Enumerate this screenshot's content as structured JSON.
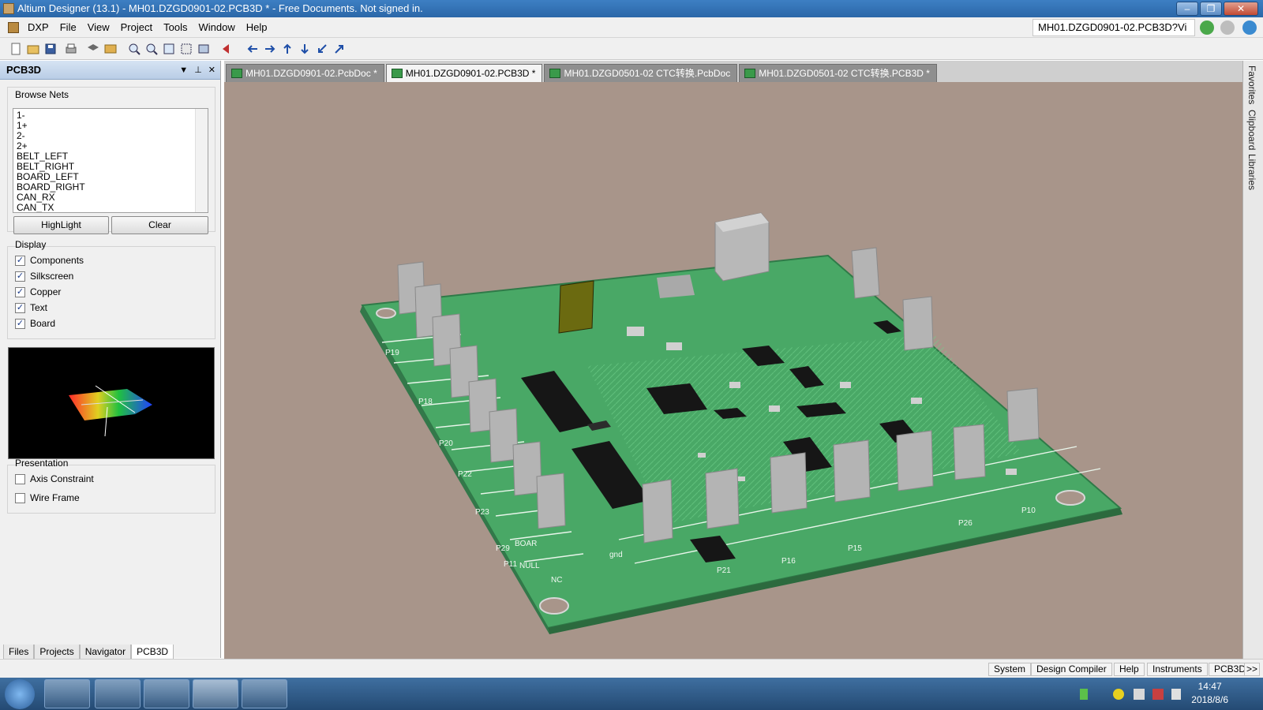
{
  "window": {
    "title": "Altium Designer (13.1) - MH01.DZGD0901-02.PCB3D * - Free Documents. Not signed in.",
    "controls": [
      "–",
      "❐",
      "✕"
    ]
  },
  "menu": {
    "dxp": "DXP",
    "items": [
      "File",
      "View",
      "Project",
      "Tools",
      "Window",
      "Help"
    ],
    "path": "MH01.DZGD0901-02.PCB3D?Vi"
  },
  "panel": {
    "title": "PCB3D",
    "header_buttons": [
      "▼",
      "⊥",
      "✕"
    ],
    "browse_nets": {
      "label": "Browse Nets",
      "nets": [
        "1-",
        "1+",
        "2-",
        "2+",
        "BELT_LEFT",
        "BELT_RIGHT",
        "BOARD_LEFT",
        "BOARD_RIGHT",
        "CAN_RX",
        "CAN_TX"
      ],
      "highlight_label": "HighLight",
      "clear_label": "Clear"
    },
    "display": {
      "label": "Display",
      "options": [
        {
          "label": "Components",
          "checked": true
        },
        {
          "label": "Silkscreen",
          "checked": true
        },
        {
          "label": "Copper",
          "checked": true
        },
        {
          "label": "Text",
          "checked": true
        },
        {
          "label": "Board",
          "checked": true
        }
      ]
    },
    "presentation": {
      "label": "Presentation",
      "options": [
        {
          "label": "Axis Constraint",
          "checked": false
        },
        {
          "label": "Wire Frame",
          "checked": false
        }
      ]
    },
    "bottom_tabs": [
      "Files",
      "Projects",
      "Navigator",
      "PCB3D"
    ],
    "active_bottom_tab": "PCB3D"
  },
  "document_tabs": [
    {
      "label": "MH01.DZGD0901-02.PcbDoc *",
      "active": false
    },
    {
      "label": "MH01.DZGD0901-02.PCB3D *",
      "active": true
    },
    {
      "label": "MH01.DZGD0501-02 CTC转换.PcbDoc",
      "active": false
    },
    {
      "label": "MH01.DZGD0501-02 CTC转换.PCB3D *",
      "active": false
    }
  ],
  "right_dock": [
    "Favorites",
    "Clipboard",
    "Libraries"
  ],
  "status_bar": {
    "buttons": [
      "System",
      "Design Compiler",
      "Help",
      "Instruments",
      "PCB3D",
      ">>"
    ]
  },
  "taskbar": {
    "time": "14:47",
    "date": "2018/8/6"
  },
  "board_labels": [
    "P19",
    "P18",
    "P20",
    "P21",
    "P22",
    "P23",
    "P29",
    "P11",
    "P16",
    "P15",
    "P26",
    "P10",
    "NULL",
    "BOAR",
    "NC",
    "gnd"
  ],
  "colors": {
    "board": "#4cb06a",
    "viewport": "#a8958a",
    "connector": "#b5b5b5",
    "ic": "#1a1a1a",
    "titlebar": "#2b67a8"
  }
}
